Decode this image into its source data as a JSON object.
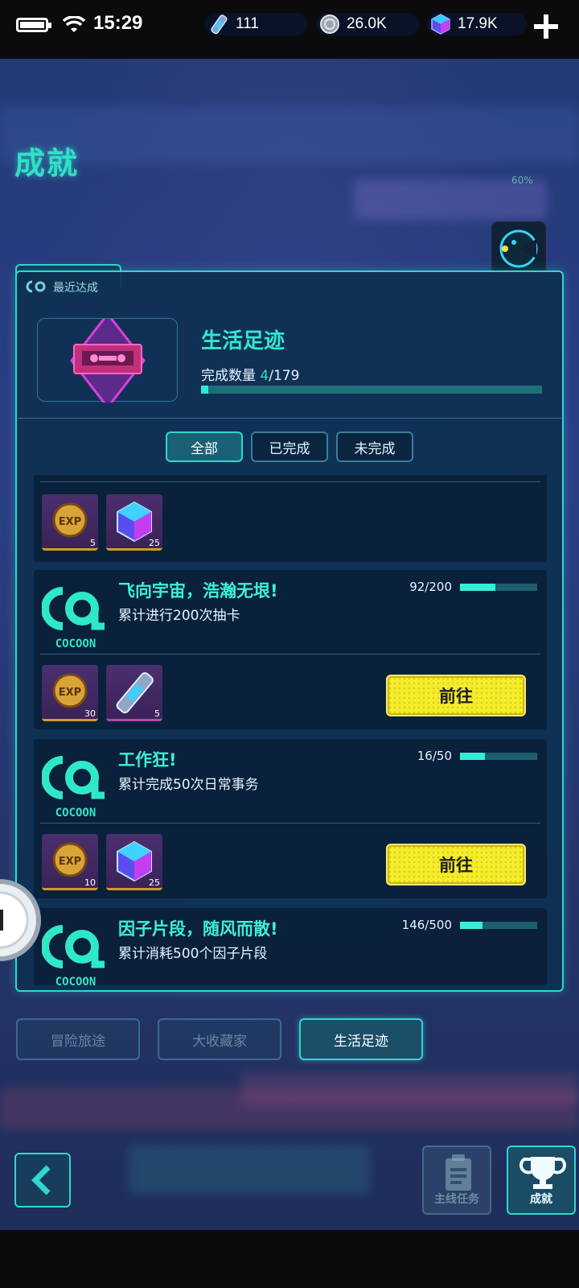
{
  "status": {
    "time": "15:29"
  },
  "currencies": {
    "tickets": "111",
    "coins": "26.0K",
    "gems": "17.9K"
  },
  "header": {
    "title": "成就",
    "percent": "60%"
  },
  "recent": {
    "label": "最近达成",
    "category": "生活足迹",
    "count_label": "完成数量",
    "count_current": "4",
    "count_total": "/179",
    "fraction": 0.022
  },
  "filters": [
    {
      "label": "全部",
      "active": true
    },
    {
      "label": "已完成",
      "active": false
    },
    {
      "label": "未完成",
      "active": false
    }
  ],
  "partial_card": {
    "rewards": [
      {
        "type": "exp-coin",
        "qty": "5"
      },
      {
        "type": "gem-cube",
        "qty": "25"
      }
    ]
  },
  "achievements": [
    {
      "title": "飞向宇宙，浩瀚无垠!",
      "desc": "累计进行200次抽卡",
      "progress": "92/200",
      "fraction": 0.46,
      "rewards": [
        {
          "type": "exp-coin",
          "qty": "30"
        },
        {
          "type": "ticket",
          "qty": "5"
        }
      ],
      "button": "前往"
    },
    {
      "title": "工作狂!",
      "desc": "累计完成50次日常事务",
      "progress": "16/50",
      "fraction": 0.32,
      "rewards": [
        {
          "type": "exp-coin",
          "qty": "10"
        },
        {
          "type": "gem-cube",
          "qty": "25"
        }
      ],
      "button": "前往"
    },
    {
      "title": "因子片段，随风而散!",
      "desc": "累计消耗500个因子片段",
      "progress": "146/500",
      "fraction": 0.29
    }
  ],
  "logo_text": "COCOON",
  "category_tabs": [
    {
      "label": "冒险旅途",
      "active": false
    },
    {
      "label": "大收藏家",
      "active": false
    },
    {
      "label": "生活足迹",
      "active": true
    }
  ],
  "bottom_nav": {
    "main_quest": "主线任务",
    "achievements": "成就"
  },
  "colors": {
    "accent": "#2fd7d0",
    "button": "#f4ec2c",
    "bg": "#2b3f86"
  }
}
